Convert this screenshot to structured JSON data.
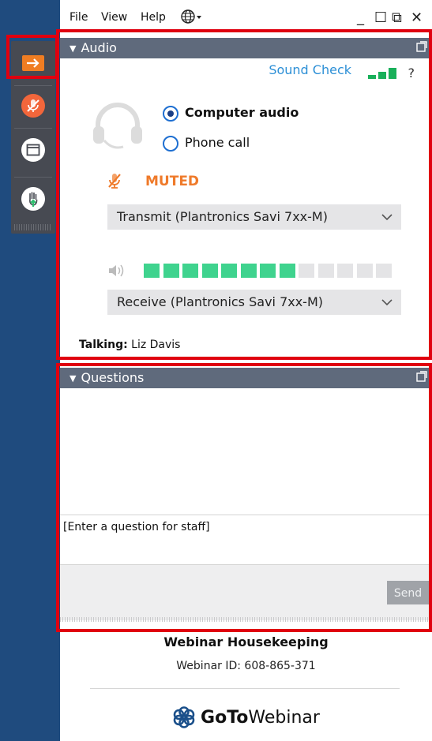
{
  "menu": {
    "file": "File",
    "view": "View",
    "help": "Help"
  },
  "window_controls": {
    "minimize": "_",
    "restore": "☐",
    "popout": "⧉",
    "close": "✕"
  },
  "rail": [
    {
      "name": "show-hide-panel",
      "icon": "arrow-right-icon",
      "color": "#f07d22"
    },
    {
      "name": "mute-toggle",
      "icon": "muted-mic-icon",
      "color": "#f2663b"
    },
    {
      "name": "screen-view",
      "icon": "window-icon",
      "color": "#ffffff"
    },
    {
      "name": "raise-hand",
      "icon": "raise-hand-icon",
      "color": "#ffffff"
    }
  ],
  "audio": {
    "header": "Audio",
    "sound_check": "Sound Check",
    "help": "?",
    "options": [
      {
        "label": "Computer audio",
        "selected": true
      },
      {
        "label": "Phone call",
        "selected": false
      }
    ],
    "status": "MUTED",
    "transmit": "Transmit (Plantronics Savi 7xx-M)",
    "receive": "Receive (Plantronics Savi 7xx-M)",
    "level": {
      "filled": 8,
      "total": 13
    },
    "talking_label": "Talking:",
    "talking_name": "Liz Davis"
  },
  "questions": {
    "header": "Questions",
    "input_placeholder": "[Enter a question for staff]",
    "send": "Send"
  },
  "footer": {
    "title": "Webinar Housekeeping",
    "webinar_id": "Webinar ID: 608-865-371",
    "brand_bold": "GoTo",
    "brand_light": "Webinar"
  },
  "colors": {
    "accent_orange": "#f07d22",
    "muted_orange": "#ef7a2a",
    "link_blue": "#2c8fd6",
    "level_green": "#3fd38e",
    "header_gray": "#5f6a7c",
    "highlight_red": "#e0000f"
  }
}
